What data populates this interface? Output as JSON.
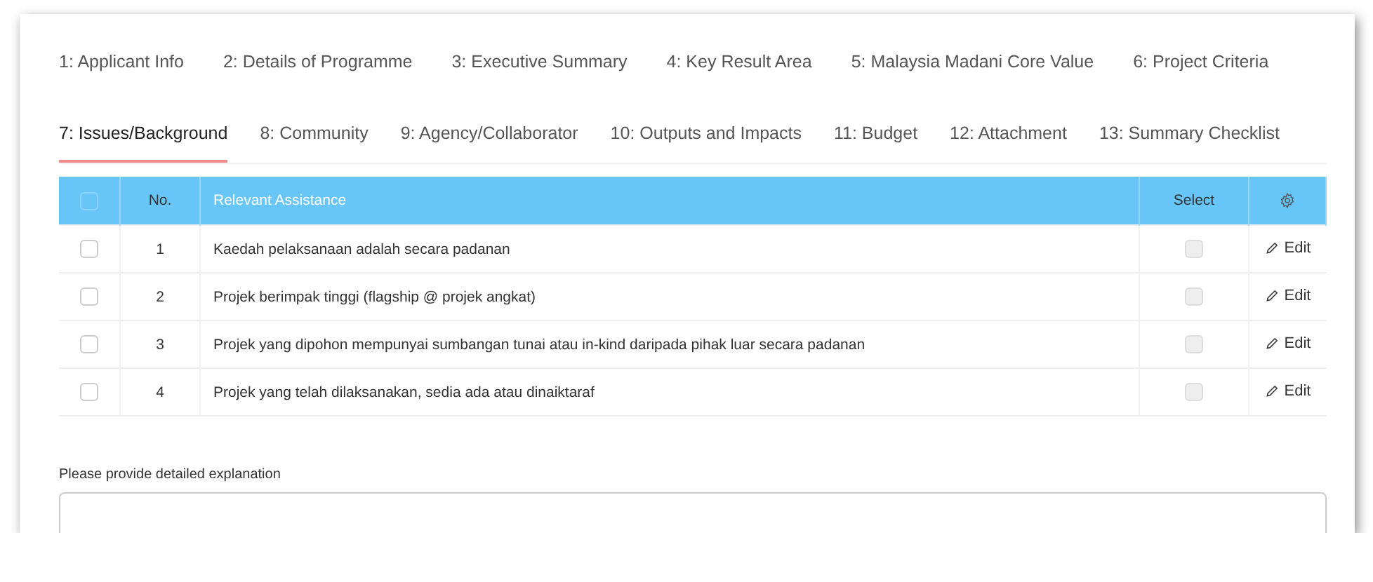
{
  "tabs": [
    {
      "label": "1: Applicant Info",
      "selected": false
    },
    {
      "label": "2: Details of Programme",
      "selected": false
    },
    {
      "label": "3: Executive Summary",
      "selected": false
    },
    {
      "label": "4: Key Result Area",
      "selected": false
    },
    {
      "label": "5: Malaysia Madani Core Value",
      "selected": false
    },
    {
      "label": "6: Project Criteria",
      "selected": false
    },
    {
      "label": "7: Issues/Background",
      "selected": true
    },
    {
      "label": "8: Community",
      "selected": false
    },
    {
      "label": "9: Agency/Collaborator",
      "selected": false
    },
    {
      "label": "10: Outputs and Impacts",
      "selected": false
    },
    {
      "label": "11: Budget",
      "selected": false
    },
    {
      "label": "12: Attachment",
      "selected": false
    },
    {
      "label": "13: Summary Checklist",
      "selected": false
    }
  ],
  "table": {
    "select_all_checked": false,
    "columns": [
      "No.",
      "Relevant Assistance",
      "Select"
    ],
    "rows": [
      {
        "checked": false,
        "no": "1",
        "text": "Kaedah pelaksanaan adalah secara padanan",
        "select": false,
        "action": "Edit"
      },
      {
        "checked": false,
        "no": "2",
        "text": "Projek berimpak tinggi (flagship @ projek angkat)",
        "select": false,
        "action": "Edit"
      },
      {
        "checked": false,
        "no": "3",
        "text": "Projek yang dipohon mempunyai sumbangan tunai atau in-kind daripada pihak luar secara padanan",
        "select": false,
        "action": "Edit"
      },
      {
        "checked": false,
        "no": "4",
        "text": "Projek yang telah dilaksanakan, sedia ada atau dinaiktaraf",
        "select": false,
        "action": "Edit"
      }
    ]
  },
  "explanation": {
    "label": "Please provide detailed explanation"
  }
}
